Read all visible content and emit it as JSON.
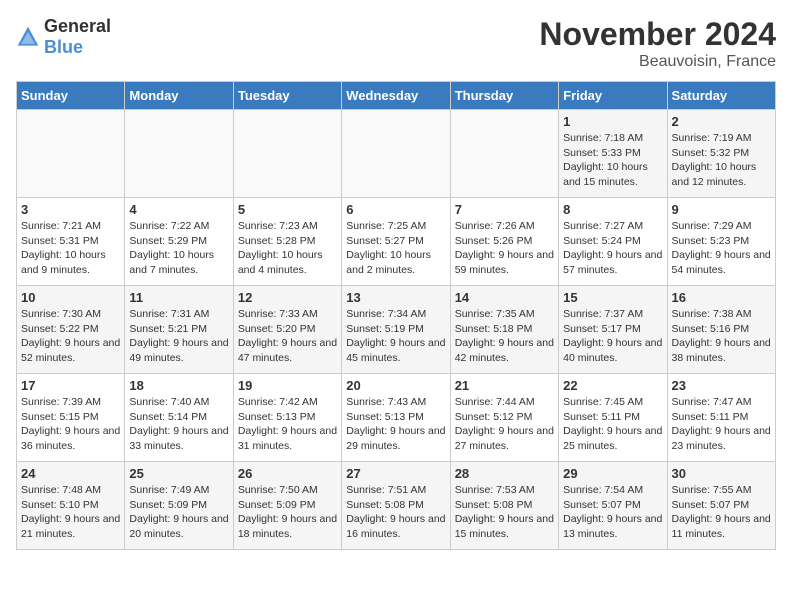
{
  "header": {
    "logo_general": "General",
    "logo_blue": "Blue",
    "month_title": "November 2024",
    "location": "Beauvoisin, France"
  },
  "days_of_week": [
    "Sunday",
    "Monday",
    "Tuesday",
    "Wednesday",
    "Thursday",
    "Friday",
    "Saturday"
  ],
  "weeks": [
    [
      {
        "day": "",
        "info": ""
      },
      {
        "day": "",
        "info": ""
      },
      {
        "day": "",
        "info": ""
      },
      {
        "day": "",
        "info": ""
      },
      {
        "day": "",
        "info": ""
      },
      {
        "day": "1",
        "info": "Sunrise: 7:18 AM\nSunset: 5:33 PM\nDaylight: 10 hours and 15 minutes."
      },
      {
        "day": "2",
        "info": "Sunrise: 7:19 AM\nSunset: 5:32 PM\nDaylight: 10 hours and 12 minutes."
      }
    ],
    [
      {
        "day": "3",
        "info": "Sunrise: 7:21 AM\nSunset: 5:31 PM\nDaylight: 10 hours and 9 minutes."
      },
      {
        "day": "4",
        "info": "Sunrise: 7:22 AM\nSunset: 5:29 PM\nDaylight: 10 hours and 7 minutes."
      },
      {
        "day": "5",
        "info": "Sunrise: 7:23 AM\nSunset: 5:28 PM\nDaylight: 10 hours and 4 minutes."
      },
      {
        "day": "6",
        "info": "Sunrise: 7:25 AM\nSunset: 5:27 PM\nDaylight: 10 hours and 2 minutes."
      },
      {
        "day": "7",
        "info": "Sunrise: 7:26 AM\nSunset: 5:26 PM\nDaylight: 9 hours and 59 minutes."
      },
      {
        "day": "8",
        "info": "Sunrise: 7:27 AM\nSunset: 5:24 PM\nDaylight: 9 hours and 57 minutes."
      },
      {
        "day": "9",
        "info": "Sunrise: 7:29 AM\nSunset: 5:23 PM\nDaylight: 9 hours and 54 minutes."
      }
    ],
    [
      {
        "day": "10",
        "info": "Sunrise: 7:30 AM\nSunset: 5:22 PM\nDaylight: 9 hours and 52 minutes."
      },
      {
        "day": "11",
        "info": "Sunrise: 7:31 AM\nSunset: 5:21 PM\nDaylight: 9 hours and 49 minutes."
      },
      {
        "day": "12",
        "info": "Sunrise: 7:33 AM\nSunset: 5:20 PM\nDaylight: 9 hours and 47 minutes."
      },
      {
        "day": "13",
        "info": "Sunrise: 7:34 AM\nSunset: 5:19 PM\nDaylight: 9 hours and 45 minutes."
      },
      {
        "day": "14",
        "info": "Sunrise: 7:35 AM\nSunset: 5:18 PM\nDaylight: 9 hours and 42 minutes."
      },
      {
        "day": "15",
        "info": "Sunrise: 7:37 AM\nSunset: 5:17 PM\nDaylight: 9 hours and 40 minutes."
      },
      {
        "day": "16",
        "info": "Sunrise: 7:38 AM\nSunset: 5:16 PM\nDaylight: 9 hours and 38 minutes."
      }
    ],
    [
      {
        "day": "17",
        "info": "Sunrise: 7:39 AM\nSunset: 5:15 PM\nDaylight: 9 hours and 36 minutes."
      },
      {
        "day": "18",
        "info": "Sunrise: 7:40 AM\nSunset: 5:14 PM\nDaylight: 9 hours and 33 minutes."
      },
      {
        "day": "19",
        "info": "Sunrise: 7:42 AM\nSunset: 5:13 PM\nDaylight: 9 hours and 31 minutes."
      },
      {
        "day": "20",
        "info": "Sunrise: 7:43 AM\nSunset: 5:13 PM\nDaylight: 9 hours and 29 minutes."
      },
      {
        "day": "21",
        "info": "Sunrise: 7:44 AM\nSunset: 5:12 PM\nDaylight: 9 hours and 27 minutes."
      },
      {
        "day": "22",
        "info": "Sunrise: 7:45 AM\nSunset: 5:11 PM\nDaylight: 9 hours and 25 minutes."
      },
      {
        "day": "23",
        "info": "Sunrise: 7:47 AM\nSunset: 5:11 PM\nDaylight: 9 hours and 23 minutes."
      }
    ],
    [
      {
        "day": "24",
        "info": "Sunrise: 7:48 AM\nSunset: 5:10 PM\nDaylight: 9 hours and 21 minutes."
      },
      {
        "day": "25",
        "info": "Sunrise: 7:49 AM\nSunset: 5:09 PM\nDaylight: 9 hours and 20 minutes."
      },
      {
        "day": "26",
        "info": "Sunrise: 7:50 AM\nSunset: 5:09 PM\nDaylight: 9 hours and 18 minutes."
      },
      {
        "day": "27",
        "info": "Sunrise: 7:51 AM\nSunset: 5:08 PM\nDaylight: 9 hours and 16 minutes."
      },
      {
        "day": "28",
        "info": "Sunrise: 7:53 AM\nSunset: 5:08 PM\nDaylight: 9 hours and 15 minutes."
      },
      {
        "day": "29",
        "info": "Sunrise: 7:54 AM\nSunset: 5:07 PM\nDaylight: 9 hours and 13 minutes."
      },
      {
        "day": "30",
        "info": "Sunrise: 7:55 AM\nSunset: 5:07 PM\nDaylight: 9 hours and 11 minutes."
      }
    ]
  ]
}
